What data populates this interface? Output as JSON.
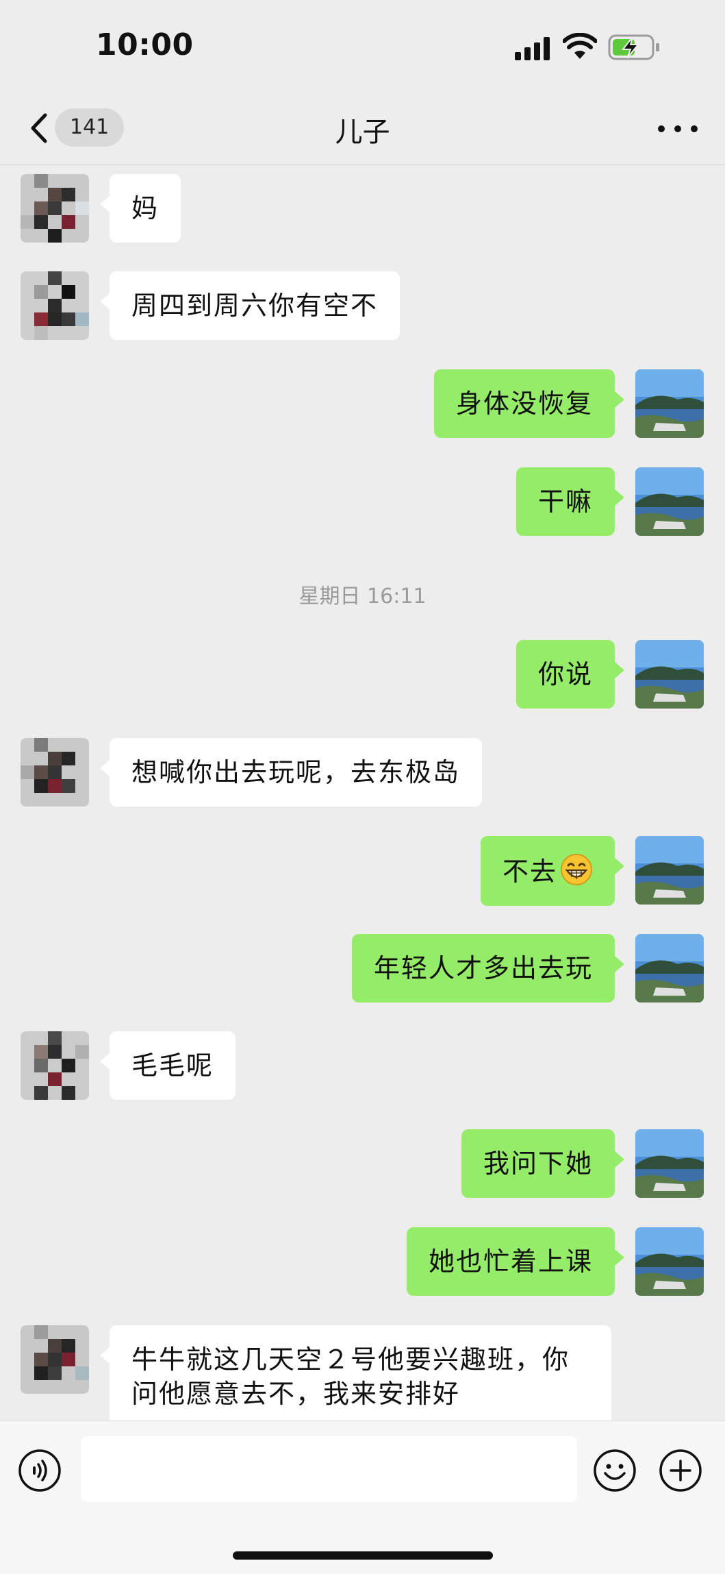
{
  "status_bar": {
    "time": "10:00"
  },
  "nav": {
    "unread_count": "141",
    "title": "儿子"
  },
  "messages": [
    {
      "side": "in",
      "text": "妈"
    },
    {
      "side": "in",
      "text": "周四到周六你有空不"
    },
    {
      "side": "out",
      "text": "身体没恢复"
    },
    {
      "side": "out",
      "text": "干嘛"
    },
    {
      "type": "timestamp",
      "text": "星期日 16:11"
    },
    {
      "side": "out",
      "text": "你说"
    },
    {
      "side": "in",
      "text": "想喊你出去玩呢，去东极岛"
    },
    {
      "side": "out",
      "text": "不去",
      "emoji": "grinning-face"
    },
    {
      "side": "out",
      "text": "年轻人才多出去玩"
    },
    {
      "side": "in",
      "text": "毛毛呢"
    },
    {
      "side": "out",
      "text": "我问下她"
    },
    {
      "side": "out",
      "text": "她也忙着上课"
    },
    {
      "side": "in",
      "text": "牛牛就这几天空２号他要兴趣班，你\n问他愿意去不，我来安排好"
    }
  ],
  "input_bar": {
    "text": ""
  },
  "colors": {
    "outgoing_bubble": "#95ec69",
    "incoming_bubble": "#ffffff",
    "background": "#ededed"
  }
}
